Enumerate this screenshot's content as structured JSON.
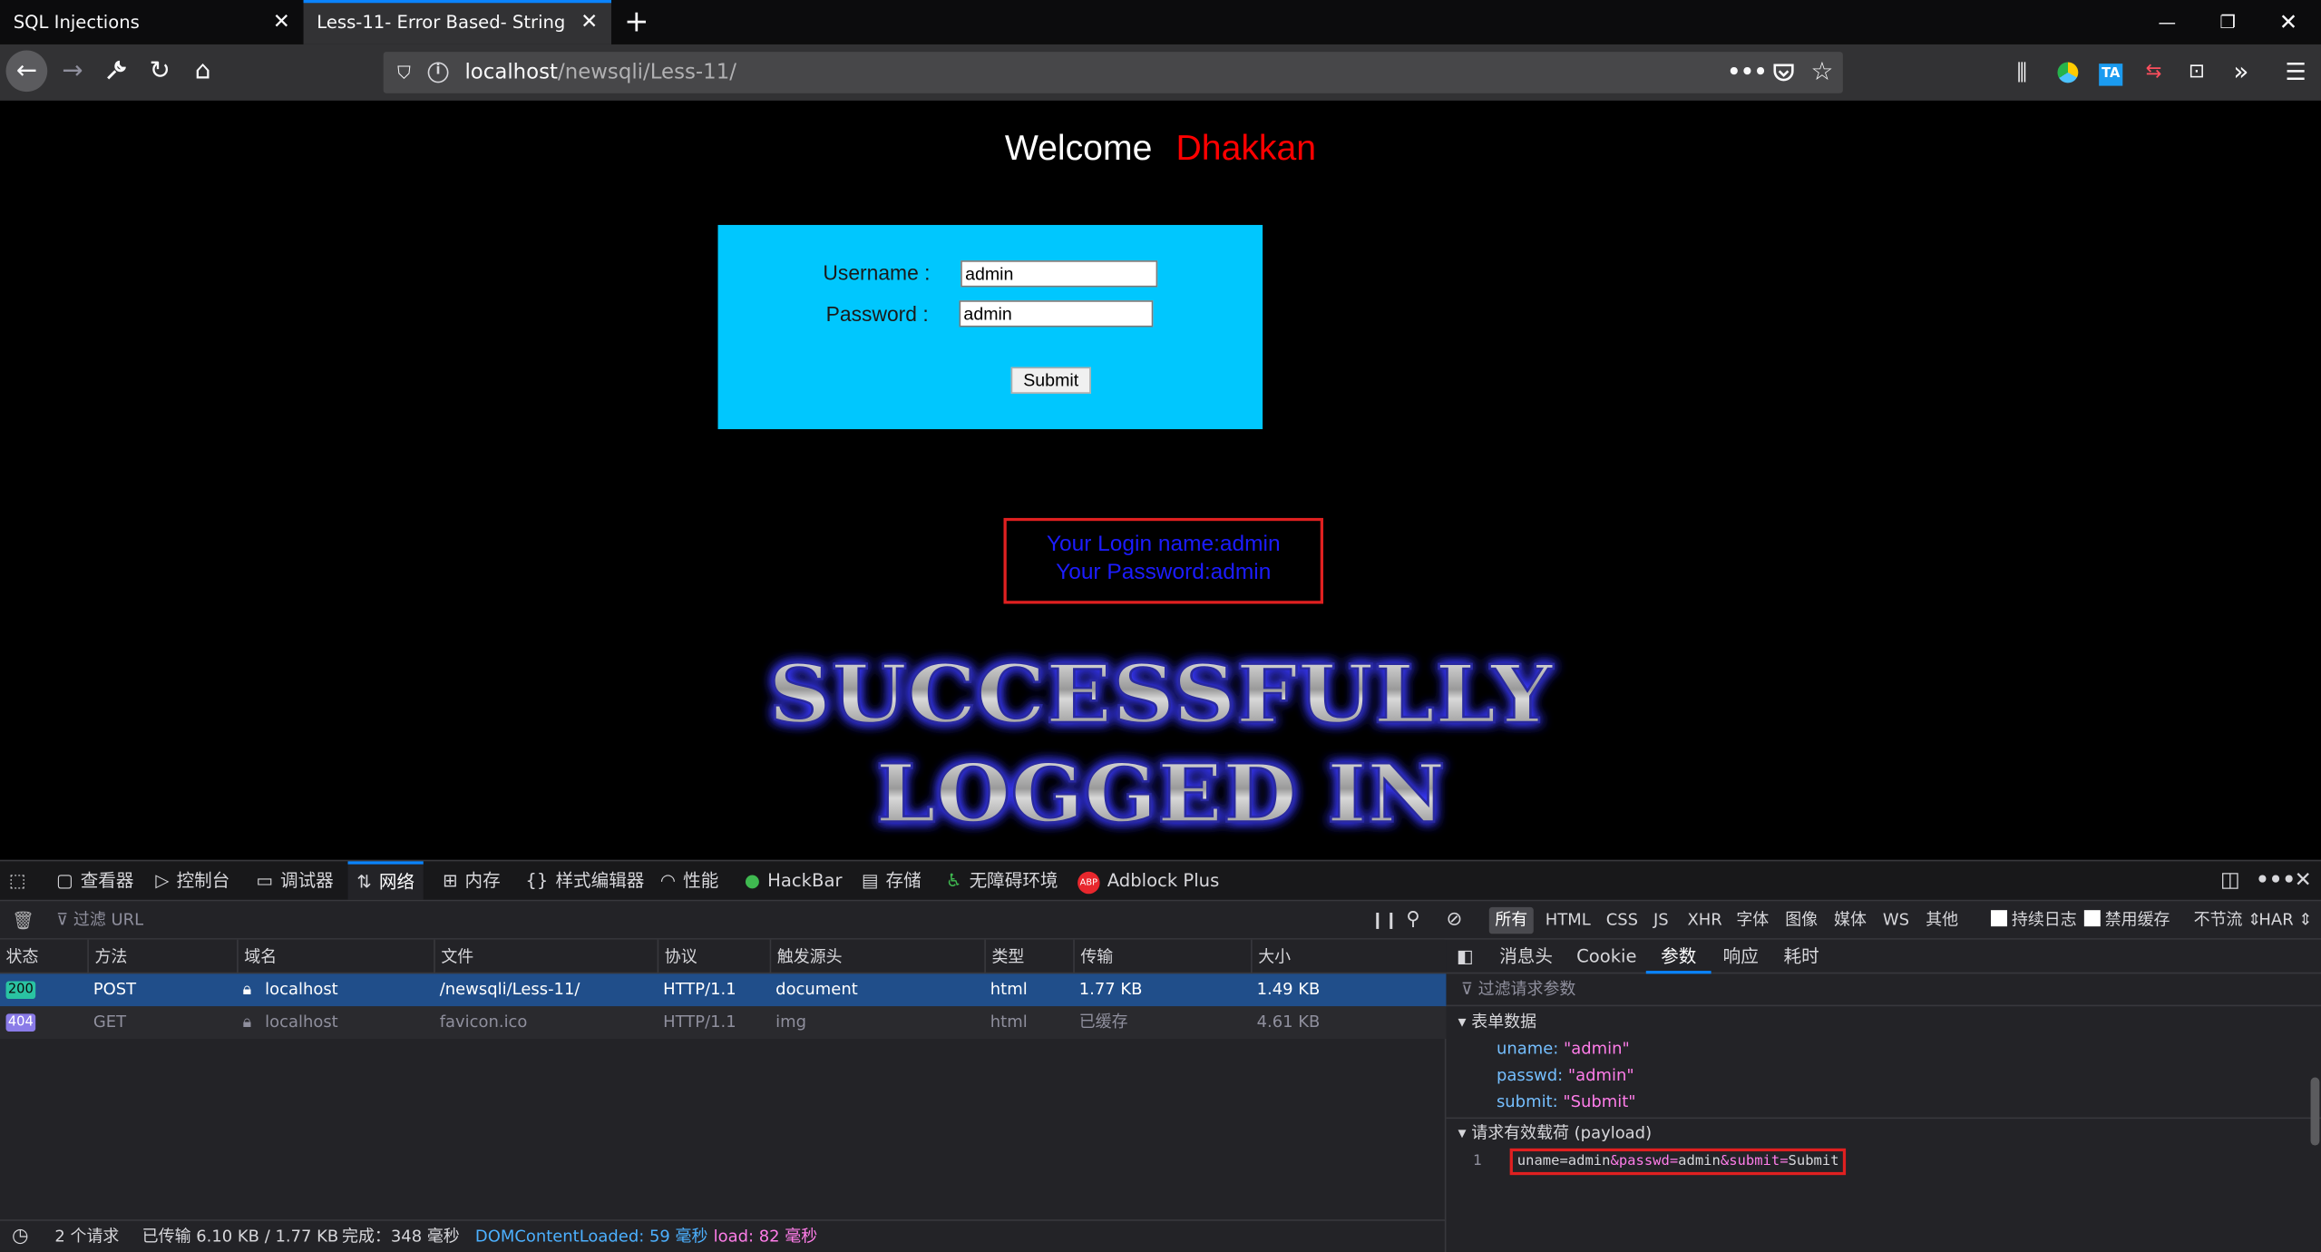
{
  "browser": {
    "tabs": [
      {
        "label": "SQL Injections"
      },
      {
        "label": "Less-11- Error Based- String"
      }
    ],
    "url": {
      "host": "localhost",
      "path": "/newsqli/Less-11/"
    }
  },
  "page": {
    "welcome": "Welcome",
    "name": "Dhakkan",
    "username_label": "Username :",
    "password_label": "Password :",
    "username_value": "admin",
    "password_value": "admin",
    "submit_label": "Submit",
    "result_line1": "Your Login name:admin",
    "result_line2": "Your Password:admin",
    "success_line1": "SUCCESSFULLY",
    "success_line2": "LOGGED IN",
    "colors": {
      "welcome_name": "#ff0000",
      "login_box": "#00c7fe",
      "result_text": "#1c1cff",
      "highlight_border": "#e02020"
    }
  },
  "devtools": {
    "tabs": [
      "查看器",
      "控制台",
      "调试器",
      "网络",
      "内存",
      "样式编辑器",
      "性能",
      "HackBar",
      "存储",
      "无障碍环境",
      "Adblock Plus"
    ],
    "active_tab": "网络",
    "filter_placeholder": "过滤 URL",
    "type_filters": [
      "所有",
      "HTML",
      "CSS",
      "JS",
      "XHR",
      "字体",
      "图像",
      "媒体",
      "WS",
      "其他"
    ],
    "persist_log": "持续日志",
    "disable_cache": "禁用缓存",
    "throttle": "不节流 ⇕",
    "har": "HAR ⇕",
    "columns": [
      "状态",
      "方法",
      "域名",
      "文件",
      "协议",
      "触发源头",
      "类型",
      "传输",
      "大小"
    ],
    "requests": [
      {
        "status": "200",
        "method": "POST",
        "domain": "localhost",
        "file": "/newsqli/Less-11/",
        "protocol": "HTTP/1.1",
        "cause": "document",
        "type": "html",
        "transferred": "1.77 KB",
        "size": "1.49 KB"
      },
      {
        "status": "404",
        "method": "GET",
        "domain": "localhost",
        "file": "favicon.ico",
        "protocol": "HTTP/1.1",
        "cause": "img",
        "type": "html",
        "transferred": "已缓存",
        "size": "4.61 KB"
      }
    ],
    "statusbar": {
      "requests": "2 个请求",
      "transferred": "已传输 6.10 KB / 1.77 KB",
      "finish": "完成：348 毫秒",
      "dcl": "DOMContentLoaded: 59 毫秒",
      "load": "load: 82 毫秒"
    },
    "side_tabs": [
      "消息头",
      "Cookie",
      "参数",
      "响应",
      "耗时"
    ],
    "side_active": "参数",
    "params_filter": "过滤请求参数",
    "form_data_title": "表单数据",
    "form_data": [
      {
        "key": "uname:",
        "value": "\"admin\""
      },
      {
        "key": "passwd:",
        "value": "\"admin\""
      },
      {
        "key": "submit:",
        "value": "\"Submit\""
      }
    ],
    "payload_title": "请求有效载荷 (payload)",
    "payload_line_no": "1",
    "payload_parts": [
      "uname=admin",
      "&passwd=",
      "admin",
      "&submit=",
      "Submit"
    ]
  }
}
